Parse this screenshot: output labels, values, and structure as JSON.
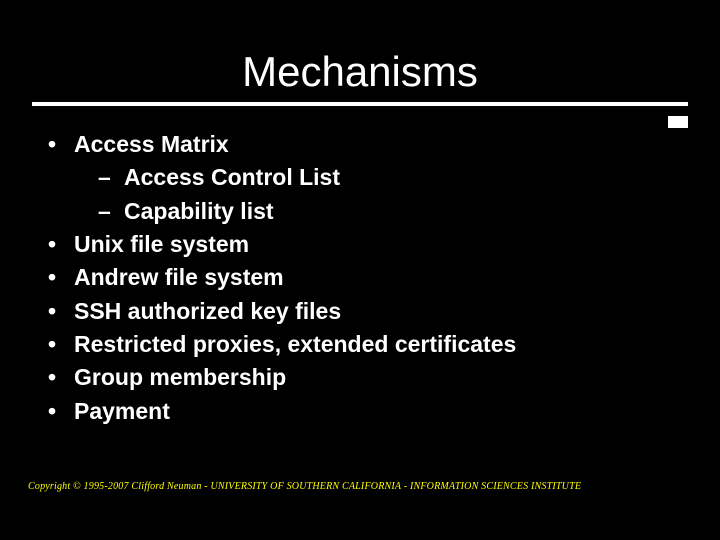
{
  "title": "Mechanisms",
  "bullets": {
    "b0": "Access Matrix",
    "b0_sub0": "Access Control List",
    "b0_sub1": "Capability list",
    "b1": "Unix file system",
    "b2": "Andrew file system",
    "b3": "SSH authorized key files",
    "b4": "Restricted proxies, extended certificates",
    "b5": "Group membership",
    "b6": "Payment"
  },
  "footer": "Copyright © 1995-2007 Clifford Neuman - UNIVERSITY OF SOUTHERN CALIFORNIA - INFORMATION SCIENCES INSTITUTE"
}
